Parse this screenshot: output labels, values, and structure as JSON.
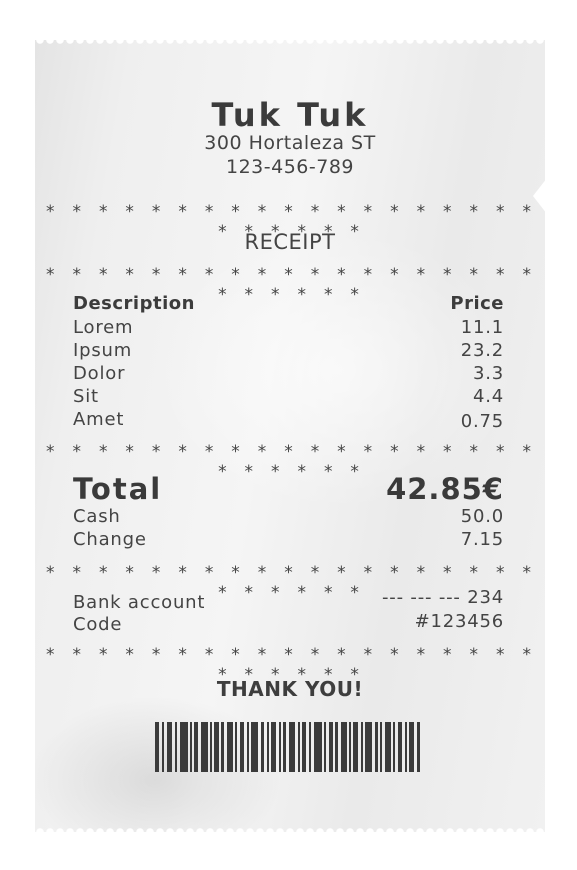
{
  "store": {
    "name": "Tuk Tuk",
    "address": "300 Hortaleza ST",
    "phone": "123-456-789"
  },
  "separator": "* * * * * * * * * * * * * * * * * * * * * * * * *",
  "title": "RECEIPT",
  "columns": {
    "description": "Description",
    "price": "Price"
  },
  "items": [
    {
      "description": "Lorem",
      "price": "11.1"
    },
    {
      "description": "Ipsum",
      "price": "23.2"
    },
    {
      "description": "Dolor",
      "price": "3.3"
    },
    {
      "description": "Sit",
      "price": "4.4"
    },
    {
      "description": "Amet",
      "price": "0.75"
    }
  ],
  "totals": {
    "total_label": "Total",
    "total_value": "42.85€",
    "cash_label": "Cash",
    "cash_value": "50.0",
    "change_label": "Change",
    "change_value": "7.15"
  },
  "payment": {
    "bank_label": "Bank account",
    "bank_value": "--- --- --- 234",
    "code_label": "Code",
    "code_value": "#123456"
  },
  "footer": {
    "thanks": "THANK YOU!"
  },
  "colors": {
    "paper": "#f0f0f0",
    "ink": "#3a3a3a",
    "background": "#ffffff"
  },
  "icons": {
    "barcode": "barcode-icon"
  }
}
